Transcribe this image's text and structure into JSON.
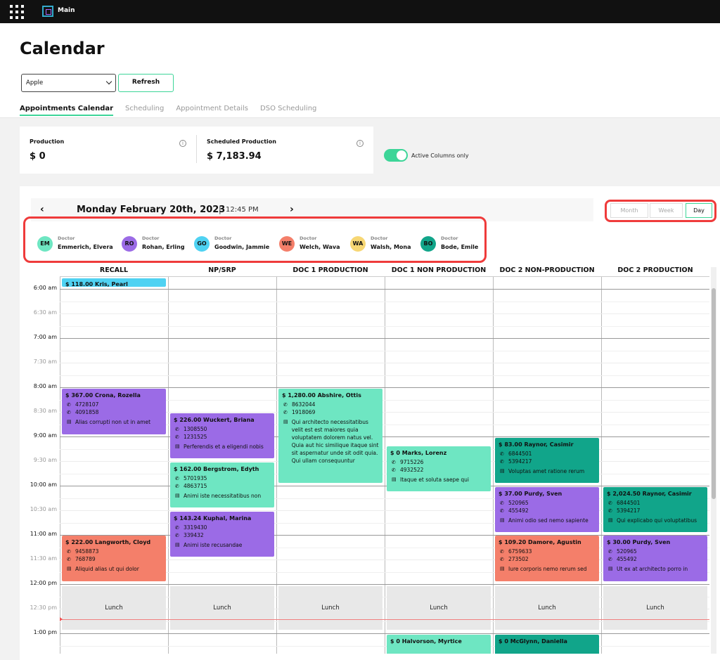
{
  "app": {
    "title": "Main"
  },
  "page": {
    "title": "Calendar"
  },
  "filter": {
    "selected": "Apple",
    "refresh_label": "Refresh"
  },
  "tabs": [
    {
      "label": "Appointments Calendar"
    },
    {
      "label": "Scheduling"
    },
    {
      "label": "Appointment Details"
    },
    {
      "label": "DSO Scheduling"
    }
  ],
  "production": {
    "label": "Production",
    "value": "$ 0"
  },
  "scheduled_production": {
    "label": "Scheduled Production",
    "value": "$ 7,183.94"
  },
  "toggle": {
    "label": "Active Columns only"
  },
  "date_nav": {
    "date": "Monday February 20th, 2023",
    "separator": "|",
    "time": "12:45 PM"
  },
  "views": [
    "Month",
    "Week",
    "Day"
  ],
  "doctors": [
    {
      "initials": "EM",
      "role": "Doctor",
      "name": "Emmerich, Elvera",
      "color": "#6ee6c2"
    },
    {
      "initials": "RO",
      "role": "Doctor",
      "name": "Rohan, Erling",
      "color": "#9b6be6"
    },
    {
      "initials": "GO",
      "role": "Doctor",
      "name": "Goodwin, Jammie",
      "color": "#4fd2f2"
    },
    {
      "initials": "WE",
      "role": "Doctor",
      "name": "Welch, Wava",
      "color": "#f47f6a"
    },
    {
      "initials": "WA",
      "role": "Doctor",
      "name": "Walsh, Mona",
      "color": "#f7d774"
    },
    {
      "initials": "BO",
      "role": "Doctor",
      "name": "Bode, Emile",
      "color": "#11a58a"
    }
  ],
  "columns": [
    "RECALL",
    "NP/SRP",
    "DOC 1 PRODUCTION",
    "DOC 1 NON PRODUCTION",
    "DOC 2 NON-PRODUCTION",
    "DOC 2 PRODUCTION"
  ],
  "times": [
    {
      "label": "6:00 am",
      "half": false
    },
    {
      "label": "6:30 am",
      "half": true
    },
    {
      "label": "7:00 am",
      "half": false
    },
    {
      "label": "7:30 am",
      "half": true
    },
    {
      "label": "8:00 am",
      "half": false
    },
    {
      "label": "8:30 am",
      "half": true
    },
    {
      "label": "9:00 am",
      "half": false
    },
    {
      "label": "9:30 am",
      "half": true
    },
    {
      "label": "10:00 am",
      "half": false
    },
    {
      "label": "10:30 am",
      "half": true
    },
    {
      "label": "11:00 am",
      "half": false
    },
    {
      "label": "11:30 am",
      "half": true
    },
    {
      "label": "12:00 pm",
      "half": false
    },
    {
      "label": "12:30 pm",
      "half": true
    },
    {
      "label": "1:00 pm",
      "half": false
    }
  ],
  "lunch_label": "Lunch",
  "appointments": {
    "a1": {
      "title": "$ 118.00 Kris, Pearl"
    },
    "a2": {
      "title": "$ 367.00 Crona, Rozella",
      "phone1": "4728107",
      "phone2": "4091858",
      "note": "Alias corrupti non ut in amet"
    },
    "a3": {
      "title": "$ 226.00 Wuckert, Briana",
      "phone1": "1308550",
      "phone2": "1231525",
      "note": "Perferendis et a eligendi nobis"
    },
    "a4": {
      "title": "$ 162.00 Bergstrom, Edyth",
      "phone1": "5701935",
      "phone2": "4863715",
      "note": "Animi iste necessitatibus non"
    },
    "a5": {
      "title": "$ 143.24 Kuphal, Marina",
      "phone1": "3319430",
      "phone2": "339432",
      "note": "Animi iste recusandae"
    },
    "a6": {
      "title": "$ 222.00 Langworth, Cloyd",
      "phone1": "9458873",
      "phone2": "768789",
      "note": "Aliquid alias ut qui dolor"
    },
    "a7": {
      "title": "$ 1,280.00 Abshire, Ottis",
      "phone1": "8632044",
      "phone2": "1918069",
      "note": "Qui architecto necessitatibus velit est est maiores quia voluptatem dolorem natus vel. Quia aut hic similique itaque sint sit aspernatur unde sit odit quia. Qui ullam consequuntur"
    },
    "a8": {
      "title": "$ 0 Marks, Lorenz",
      "phone1": "9715226",
      "phone2": "4932522",
      "note": "Itaque et soluta saepe qui"
    },
    "a9": {
      "title": "$ 83.00 Raynor, Casimir",
      "phone1": "6844501",
      "phone2": "5394217",
      "note": "Voluptas amet ratione rerum"
    },
    "a10": {
      "title": "$ 37.00 Purdy, Sven",
      "phone1": "520965",
      "phone2": "455492",
      "note": "Animi odio sed nemo sapiente"
    },
    "a11": {
      "title": "$ 109.20 Damore, Agustin",
      "phone1": "6759633",
      "phone2": "273502",
      "note": "Iure corporis nemo rerum sed"
    },
    "a12": {
      "title": "$ 2,024.50 Raynor, Casimir",
      "phone1": "6844501",
      "phone2": "5394217",
      "note": "Qui explicabo qui voluptatibus"
    },
    "a13": {
      "title": "$ 30.00 Purdy, Sven",
      "phone1": "520965",
      "phone2": "455492",
      "note": "Ut ex at architecto porro in"
    },
    "a14": {
      "title": "$ 0 Halvorson, Myrtice"
    },
    "a15": {
      "title": "$ 0 McGlynn, Daniella"
    }
  }
}
